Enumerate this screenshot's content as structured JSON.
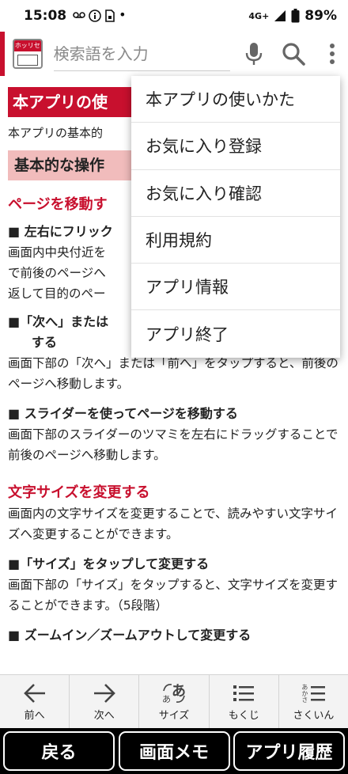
{
  "status_bar": {
    "time": "15:08",
    "network": "4G+",
    "battery": "89%"
  },
  "app_bar": {
    "logo_text": "ホッリセン",
    "search_placeholder": "検索語を入力"
  },
  "content": {
    "section_title": "本アプリの使",
    "intro": "本アプリの基本的",
    "subsection_title": "基本的な操作",
    "heading_page_move": "ページを移動す",
    "item1_heading": "■ 左右にフリック",
    "item1_lines": [
      "画面内中央付近を",
      "で前後のページへ",
      "返して目的のペー"
    ],
    "item2_heading_a": "■「次へ」または",
    "item2_heading_b": "する",
    "item2_body": "画面下部の「次へ」または「前へ」をタップすると、前後のページへ移動します。",
    "item3_heading": "■ スライダーを使ってページを移動する",
    "item3_body": "画面下部のスライダーのツマミを左右にドラッグすることで前後のページへ移動します。",
    "heading_font_size": "文字サイズを変更する",
    "font_intro": "画面内の文字サイズを変更することで、読みやすい文字サイズへ変更することができます。",
    "item4_heading": "■「サイズ」をタップして変更する",
    "item4_body": "画面下部の「サイズ」をタップすると、文字サイズを変更することができます。（5段階）",
    "item5_heading": "■ ズームイン／ズームアウトして変更する"
  },
  "menu": {
    "items": [
      "本アプリの使いかた",
      "お気に入り登録",
      "お気に入り確認",
      "利用規約",
      "アプリ情報",
      "アプリ終了"
    ]
  },
  "bottom_nav": {
    "prev": "前へ",
    "next": "次へ",
    "size": "サイズ",
    "size_icon_text": "あ",
    "toc": "もくじ",
    "index": "さくいん",
    "index_icon_text": "あかさ"
  },
  "bottom_actions": {
    "back": "戻る",
    "memo": "画面メモ",
    "history": "アプリ履歴"
  },
  "colors": {
    "accent_red": "#c8102e",
    "subsection_pink": "#f1bcbc",
    "toolbar_bg": "#f3f3f3"
  }
}
